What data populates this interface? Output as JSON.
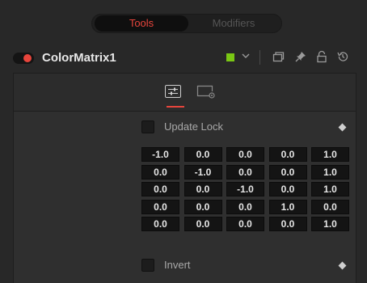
{
  "tabs": {
    "tools": "Tools",
    "modifiers": "Modifiers"
  },
  "node": {
    "name": "ColorMatrix1",
    "enabled": true,
    "accent": "#e8453c",
    "swatch_color": "#7ac714"
  },
  "controls": {
    "update_lock_label": "Update Lock",
    "invert_label": "Invert"
  },
  "matrix": [
    [
      "-1.0",
      "0.0",
      "0.0",
      "0.0",
      "1.0"
    ],
    [
      "0.0",
      "-1.0",
      "0.0",
      "0.0",
      "1.0"
    ],
    [
      "0.0",
      "0.0",
      "-1.0",
      "0.0",
      "1.0"
    ],
    [
      "0.0",
      "0.0",
      "0.0",
      "1.0",
      "0.0"
    ],
    [
      "0.0",
      "0.0",
      "0.0",
      "0.0",
      "1.0"
    ]
  ],
  "icons": {
    "header": [
      "chevron-down-icon",
      "window-icon",
      "pin-icon",
      "lock-icon",
      "reset-icon"
    ],
    "panel_tabs": [
      "sliders-icon",
      "settings-icon"
    ]
  }
}
